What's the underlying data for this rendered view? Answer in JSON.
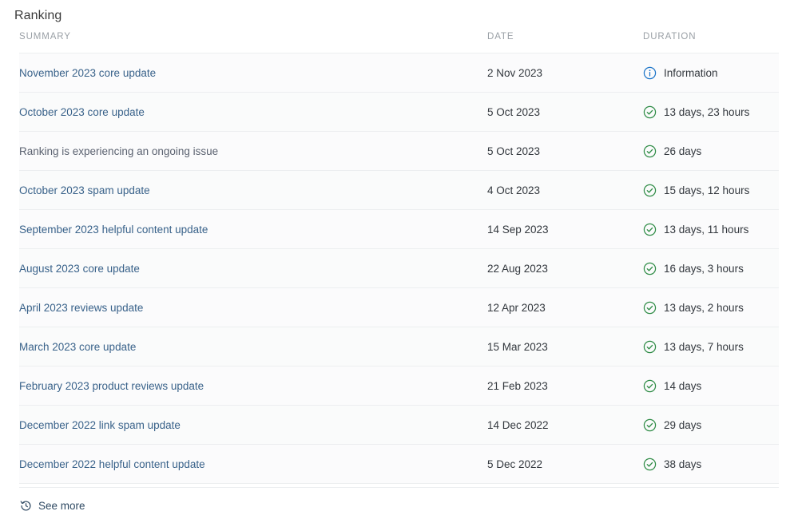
{
  "panel": {
    "title": "Ranking"
  },
  "table": {
    "columns": [
      {
        "key": "summary",
        "label": "SUMMARY"
      },
      {
        "key": "date",
        "label": "DATE"
      },
      {
        "key": "duration",
        "label": "DURATION"
      }
    ],
    "rows": [
      {
        "summary": "November 2023 core update",
        "is_link": true,
        "date": "2 Nov 2023",
        "status": "information",
        "icon": "info-circle-icon",
        "duration": "Information"
      },
      {
        "summary": "October 2023 core update",
        "is_link": true,
        "date": "5 Oct 2023",
        "status": "resolved",
        "icon": "check-circle-icon",
        "duration": "13 days, 23 hours"
      },
      {
        "summary": "Ranking is experiencing an ongoing issue",
        "is_link": false,
        "date": "5 Oct 2023",
        "status": "resolved",
        "icon": "check-circle-icon",
        "duration": "26 days"
      },
      {
        "summary": "October 2023 spam update",
        "is_link": true,
        "date": "4 Oct 2023",
        "status": "resolved",
        "icon": "check-circle-icon",
        "duration": "15 days, 12 hours"
      },
      {
        "summary": "September 2023 helpful content update",
        "is_link": true,
        "date": "14 Sep 2023",
        "status": "resolved",
        "icon": "check-circle-icon",
        "duration": "13 days, 11 hours"
      },
      {
        "summary": "August 2023 core update",
        "is_link": true,
        "date": "22 Aug 2023",
        "status": "resolved",
        "icon": "check-circle-icon",
        "duration": "16 days, 3 hours"
      },
      {
        "summary": "April 2023 reviews update",
        "is_link": true,
        "date": "12 Apr 2023",
        "status": "resolved",
        "icon": "check-circle-icon",
        "duration": "13 days, 2 hours"
      },
      {
        "summary": "March 2023 core update",
        "is_link": true,
        "date": "15 Mar 2023",
        "status": "resolved",
        "icon": "check-circle-icon",
        "duration": "13 days, 7 hours"
      },
      {
        "summary": "February 2023 product reviews update",
        "is_link": true,
        "date": "21 Feb 2023",
        "status": "resolved",
        "icon": "check-circle-icon",
        "duration": "14 days"
      },
      {
        "summary": "December 2022 link spam update",
        "is_link": true,
        "date": "14 Dec 2022",
        "status": "resolved",
        "icon": "check-circle-icon",
        "duration": "29 days"
      },
      {
        "summary": "December 2022 helpful content update",
        "is_link": true,
        "date": "5 Dec 2022",
        "status": "resolved",
        "icon": "check-circle-icon",
        "duration": "38 days"
      }
    ]
  },
  "footer": {
    "see_more_label": "See more",
    "see_more_icon": "history-clock-icon"
  },
  "colors": {
    "link": "#39628a",
    "plain_text": "#5b6270",
    "value_text": "#32373d",
    "header_text": "#9aa0a6",
    "title_text": "#3a3a3a",
    "info_blue": "#1a73c8",
    "resolved_green": "#2e8b45",
    "row_bg": "#fbfbfc",
    "divider": "#eceef0",
    "page_bg": "#ffffff"
  }
}
